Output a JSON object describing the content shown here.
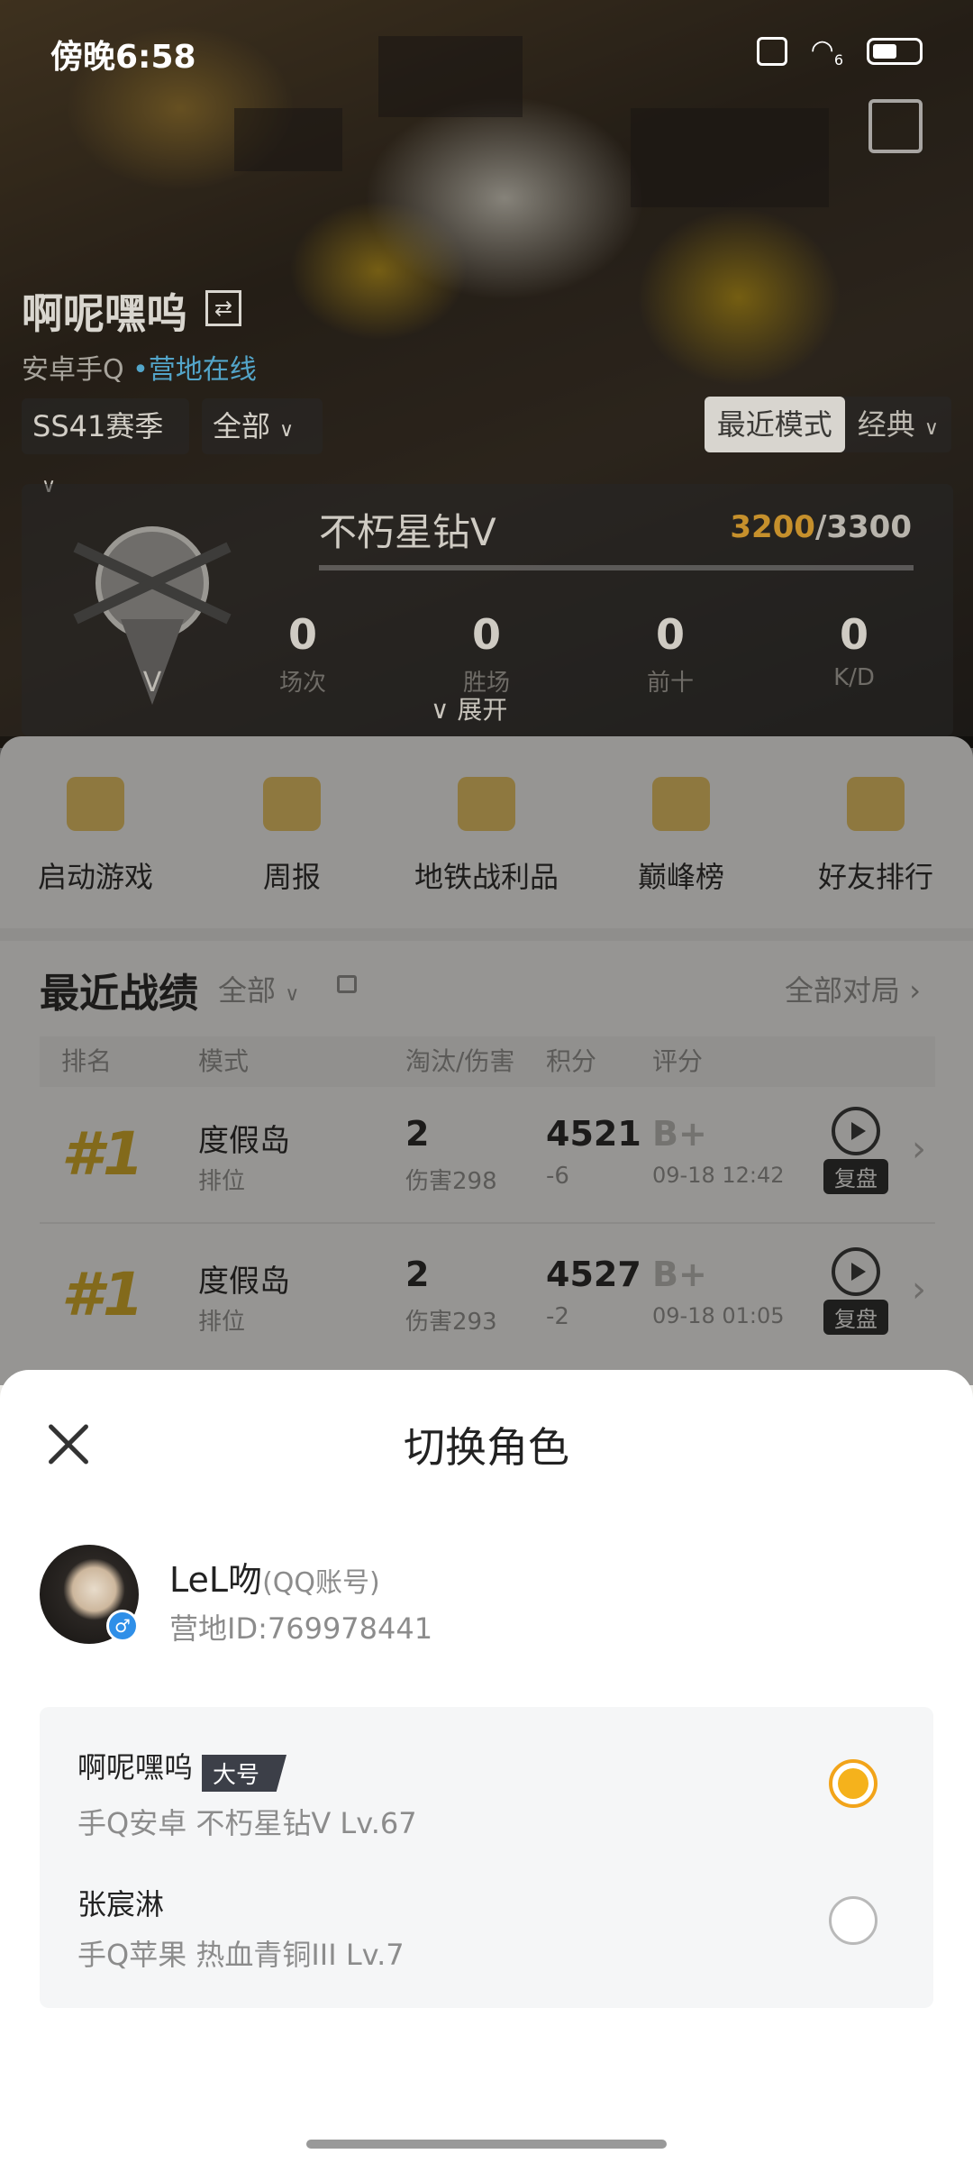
{
  "status_bar": {
    "time": "傍晚6:58",
    "wifi_badge": "6"
  },
  "profile": {
    "name": "啊呢嘿呜",
    "platform": "安卓手Q",
    "status": "营地在线",
    "season": "SS41赛季",
    "scope": "全部",
    "mode_tabs": [
      "最近模式",
      "经典"
    ]
  },
  "rank": {
    "tier": "不朽星钻V",
    "score_current": "3200",
    "score_total": "/3300",
    "stats": [
      {
        "value": "0",
        "label": "场次"
      },
      {
        "value": "0",
        "label": "胜场"
      },
      {
        "value": "0",
        "label": "前十"
      },
      {
        "value": "0",
        "label": "K/D"
      }
    ],
    "expand_label": "展开"
  },
  "quick_actions": [
    "启动游戏",
    "周报",
    "地铁战利品",
    "巅峰榜",
    "好友排行"
  ],
  "records": {
    "title": "最近战绩",
    "filter": "全部",
    "all_games": "全部对局",
    "columns": [
      "排名",
      "模式",
      "淘汰/伤害",
      "积分",
      "评分"
    ],
    "rows": [
      {
        "rank": "#1",
        "mode": "度假岛",
        "type": "排位",
        "kills": "2",
        "damage": "伤害298",
        "points": "4521",
        "delta": "-6",
        "grade": "B+",
        "date": "09-18 12:42",
        "replay": "复盘"
      },
      {
        "rank": "#1",
        "mode": "度假岛",
        "type": "排位",
        "kills": "2",
        "damage": "伤害293",
        "points": "4527",
        "delta": "-2",
        "grade": "B+",
        "date": "09-18 01:05",
        "replay": "复盘"
      }
    ]
  },
  "sheet": {
    "title": "切换角色",
    "account_name": "LeL吻",
    "account_tag": "(QQ账号)",
    "account_id": "营地ID:769978441",
    "roles": [
      {
        "name": "啊呢嘿呜",
        "badge": "大号",
        "desc": "手Q安卓  不朽星钻V  Lv.67",
        "selected": true
      },
      {
        "name": "张宸淋",
        "badge": "",
        "desc": "手Q苹果  热血青铜III  Lv.7",
        "selected": false
      }
    ]
  },
  "colors": {
    "accent": "#f5b21c",
    "rank_gold": "#c9a32a"
  }
}
